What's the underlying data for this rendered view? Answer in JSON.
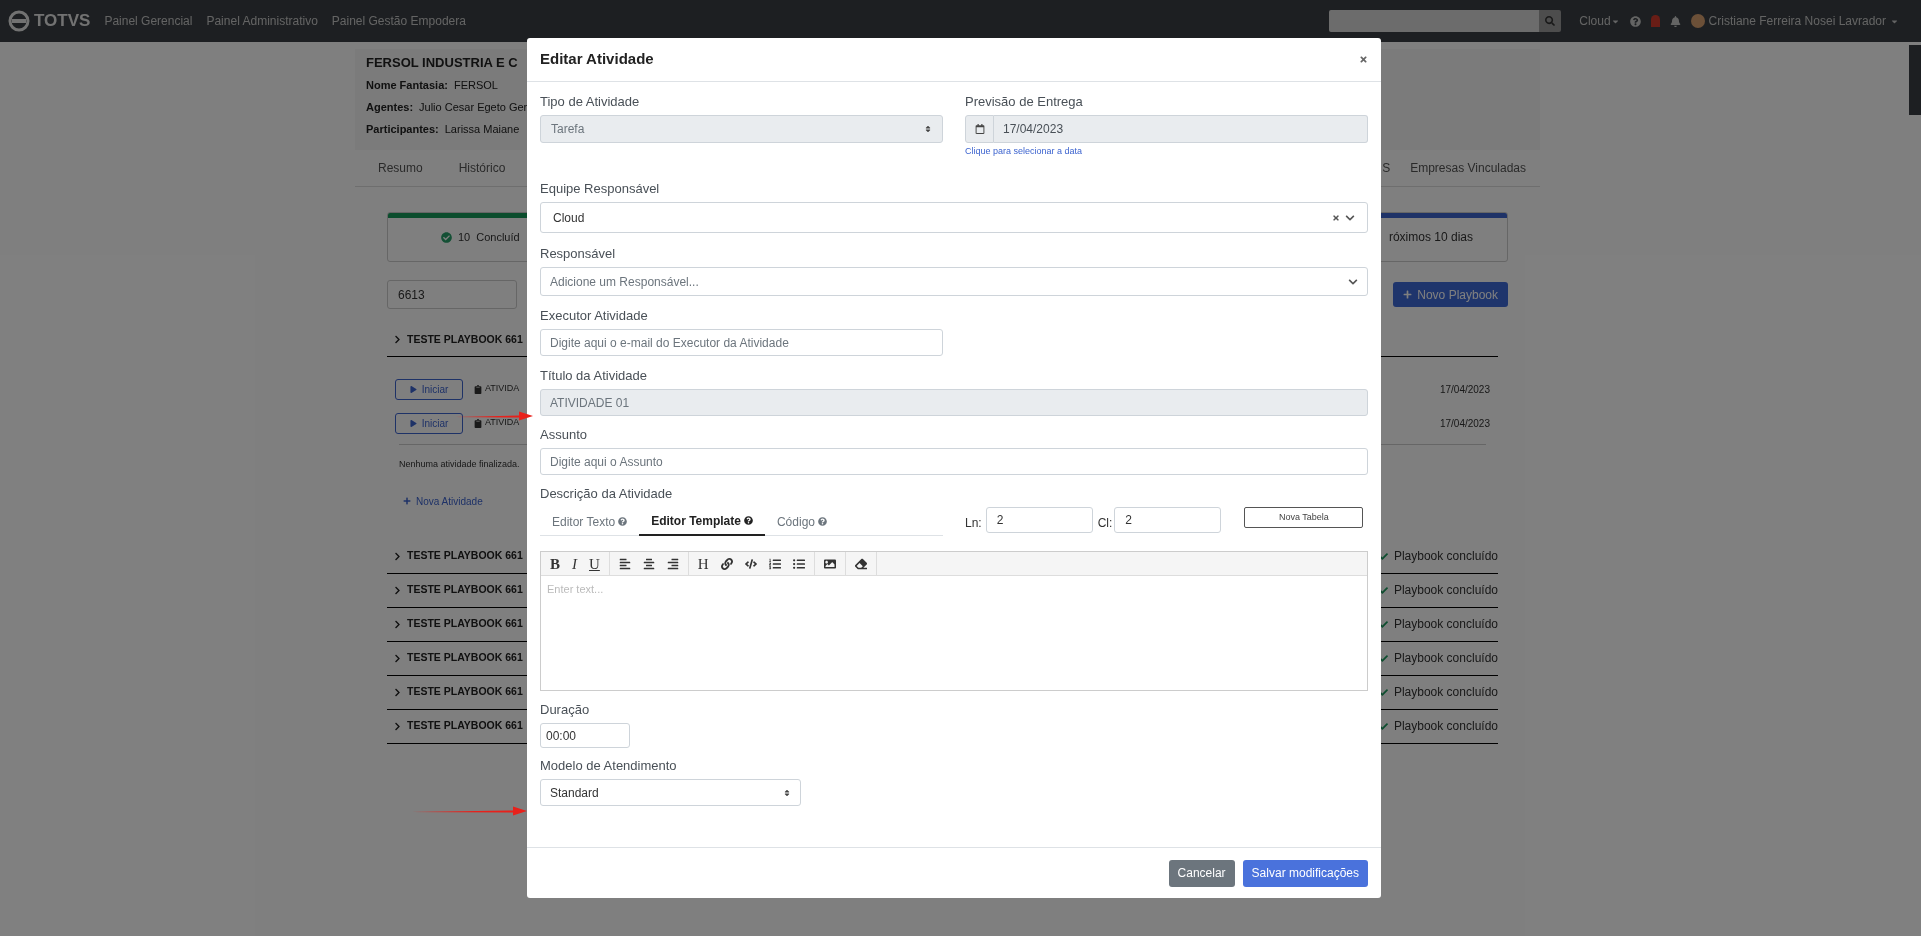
{
  "topbar": {
    "logo": "TOTVS",
    "nav": [
      "Painel Gerencial",
      "Painel Administrativo",
      "Painel Gestão Empodera"
    ],
    "team": "Cloud",
    "user": "Cristiane Ferreira Nosei Lavrador"
  },
  "company": {
    "name": "FERSOL INDUSTRIA E C",
    "fields": [
      {
        "label": "Nome Fantasia:",
        "value": "FERSOL"
      },
      {
        "label": "Agentes:",
        "value": "Julio Cesar Egeto Ger"
      },
      {
        "label": "Participantes:",
        "value": "Larissa Maiane"
      }
    ]
  },
  "tabs_left": [
    "Resumo",
    "Histórico"
  ],
  "tabs_right": [
    "S",
    "Empresas Vinculadas"
  ],
  "summary": {
    "count": "10",
    "label": "Concluíd",
    "upcoming": "róximos 10 dias"
  },
  "search": {
    "value": "6613"
  },
  "new_playbook": "Novo Playbook",
  "playbooks": [
    {
      "title": "TESTE PLAYBOOK 661",
      "expanded": true,
      "activities": [
        {
          "button": "Iniciar",
          "name": "ATIVIDA",
          "date": "17/04/2023"
        },
        {
          "button": "Iniciar",
          "name": "ATIVIDA",
          "date": "17/04/2023"
        }
      ],
      "empty_note": "Nenhuma atividade finalizada.",
      "add_label": "Nova Atividade"
    },
    {
      "title": "TESTE PLAYBOOK 661",
      "expanded": false,
      "status": "Playbook concluído"
    },
    {
      "title": "TESTE PLAYBOOK 661",
      "expanded": false,
      "status": "Playbook concluído"
    },
    {
      "title": "TESTE PLAYBOOK 661",
      "expanded": false,
      "status": "Playbook concluído"
    },
    {
      "title": "TESTE PLAYBOOK 661",
      "expanded": false,
      "status": "Playbook concluído"
    },
    {
      "title": "TESTE PLAYBOOK 661",
      "expanded": false,
      "status": "Playbook concluído"
    },
    {
      "title": "TESTE PLAYBOOK 661",
      "expanded": false,
      "status": "Playbook concluído"
    }
  ],
  "modal": {
    "title": "Editar Atividade",
    "tipo": {
      "label": "Tipo de Atividade",
      "value": "Tarefa",
      "disabled": true
    },
    "previsao": {
      "label": "Previsão de Entrega",
      "value": "17/04/2023",
      "hint": "Clique para selecionar a data"
    },
    "equipe": {
      "label": "Equipe Responsável",
      "value": "Cloud"
    },
    "responsavel": {
      "label": "Responsável",
      "placeholder": "Adicione um Responsável..."
    },
    "executor": {
      "label": "Executor Atividade",
      "placeholder": "Digite aqui o e-mail do Executor da Atividade"
    },
    "titulo": {
      "label": "Título da Atividade",
      "value": "ATIVIDADE 01",
      "disabled": true
    },
    "assunto": {
      "label": "Assunto",
      "placeholder": "Digite aqui o Assunto"
    },
    "descricao": {
      "label": "Descrição da Atividade",
      "tabs": [
        {
          "label": "Editor Texto",
          "selected": false
        },
        {
          "label": "Editor Template",
          "selected": true
        },
        {
          "label": "Código",
          "selected": false
        }
      ],
      "ln": {
        "label": "Ln:",
        "value": "2"
      },
      "cl": {
        "label": "Cl:",
        "value": "2"
      },
      "new_table": "Nova Tabela",
      "toolbar": [
        [
          {
            "kind": "bold",
            "label": "B"
          },
          {
            "kind": "italic",
            "label": "I"
          },
          {
            "kind": "underline",
            "label": "U"
          }
        ],
        [
          {
            "kind": "align-left"
          },
          {
            "kind": "align-center"
          },
          {
            "kind": "align-right"
          }
        ],
        [
          {
            "kind": "heading",
            "label": "H"
          },
          {
            "kind": "link"
          },
          {
            "kind": "code"
          },
          {
            "kind": "ordered-list"
          },
          {
            "kind": "bullet-list"
          }
        ],
        [
          {
            "kind": "image"
          }
        ],
        [
          {
            "kind": "eraser"
          }
        ]
      ],
      "editor_placeholder": "Enter text..."
    },
    "duracao": {
      "label": "Duração",
      "value": "00:00"
    },
    "modelo": {
      "label": "Modelo de Atendimento",
      "value": "Standard"
    },
    "buttons": [
      {
        "label": "Cancelar",
        "kind": "secondary"
      },
      {
        "label": "Salvar modificações",
        "kind": "primary"
      }
    ]
  }
}
